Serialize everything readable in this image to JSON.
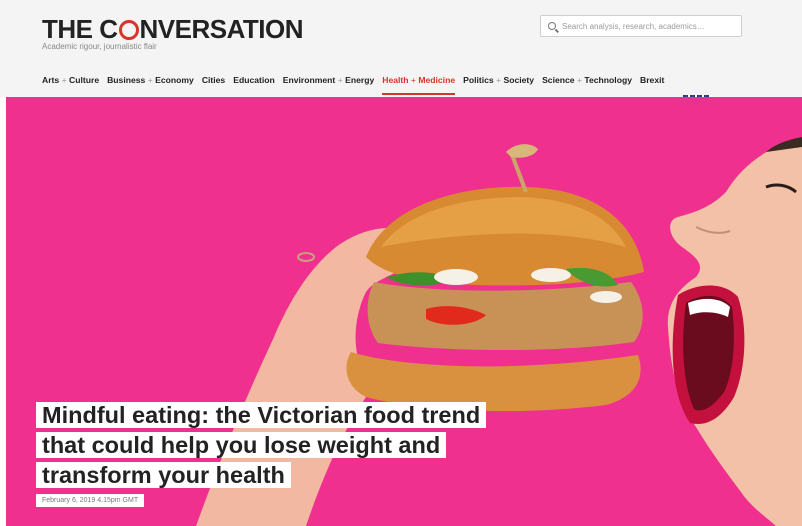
{
  "brand": {
    "logo_before": "THE C",
    "logo_after": "NVERSATION",
    "tagline": "Academic rigour, journalistic flair"
  },
  "search": {
    "placeholder": "Search analysis, research, academics…"
  },
  "nav": {
    "items": [
      {
        "a": "Arts",
        "b": "Culture"
      },
      {
        "a": "Business",
        "b": "Economy"
      },
      {
        "a": "Cities",
        "b": ""
      },
      {
        "a": "Education",
        "b": ""
      },
      {
        "a": "Environment",
        "b": "Energy"
      },
      {
        "a": "Health",
        "b": "Medicine"
      },
      {
        "a": "Politics",
        "b": "Society"
      },
      {
        "a": "Science",
        "b": "Technology"
      },
      {
        "a": "Brexit",
        "b": ""
      }
    ],
    "plus": "+",
    "active_index": 5
  },
  "article": {
    "headline_lines": [
      "Mindful eating: the Victorian food trend",
      "that could help you lose weight and",
      "transform your health"
    ],
    "date": "February 6, 2019 4.15pm GMT"
  },
  "colors": {
    "accent": "#d8352a",
    "hero_background": "#f0308f"
  },
  "icons": {
    "search": "search-icon"
  }
}
